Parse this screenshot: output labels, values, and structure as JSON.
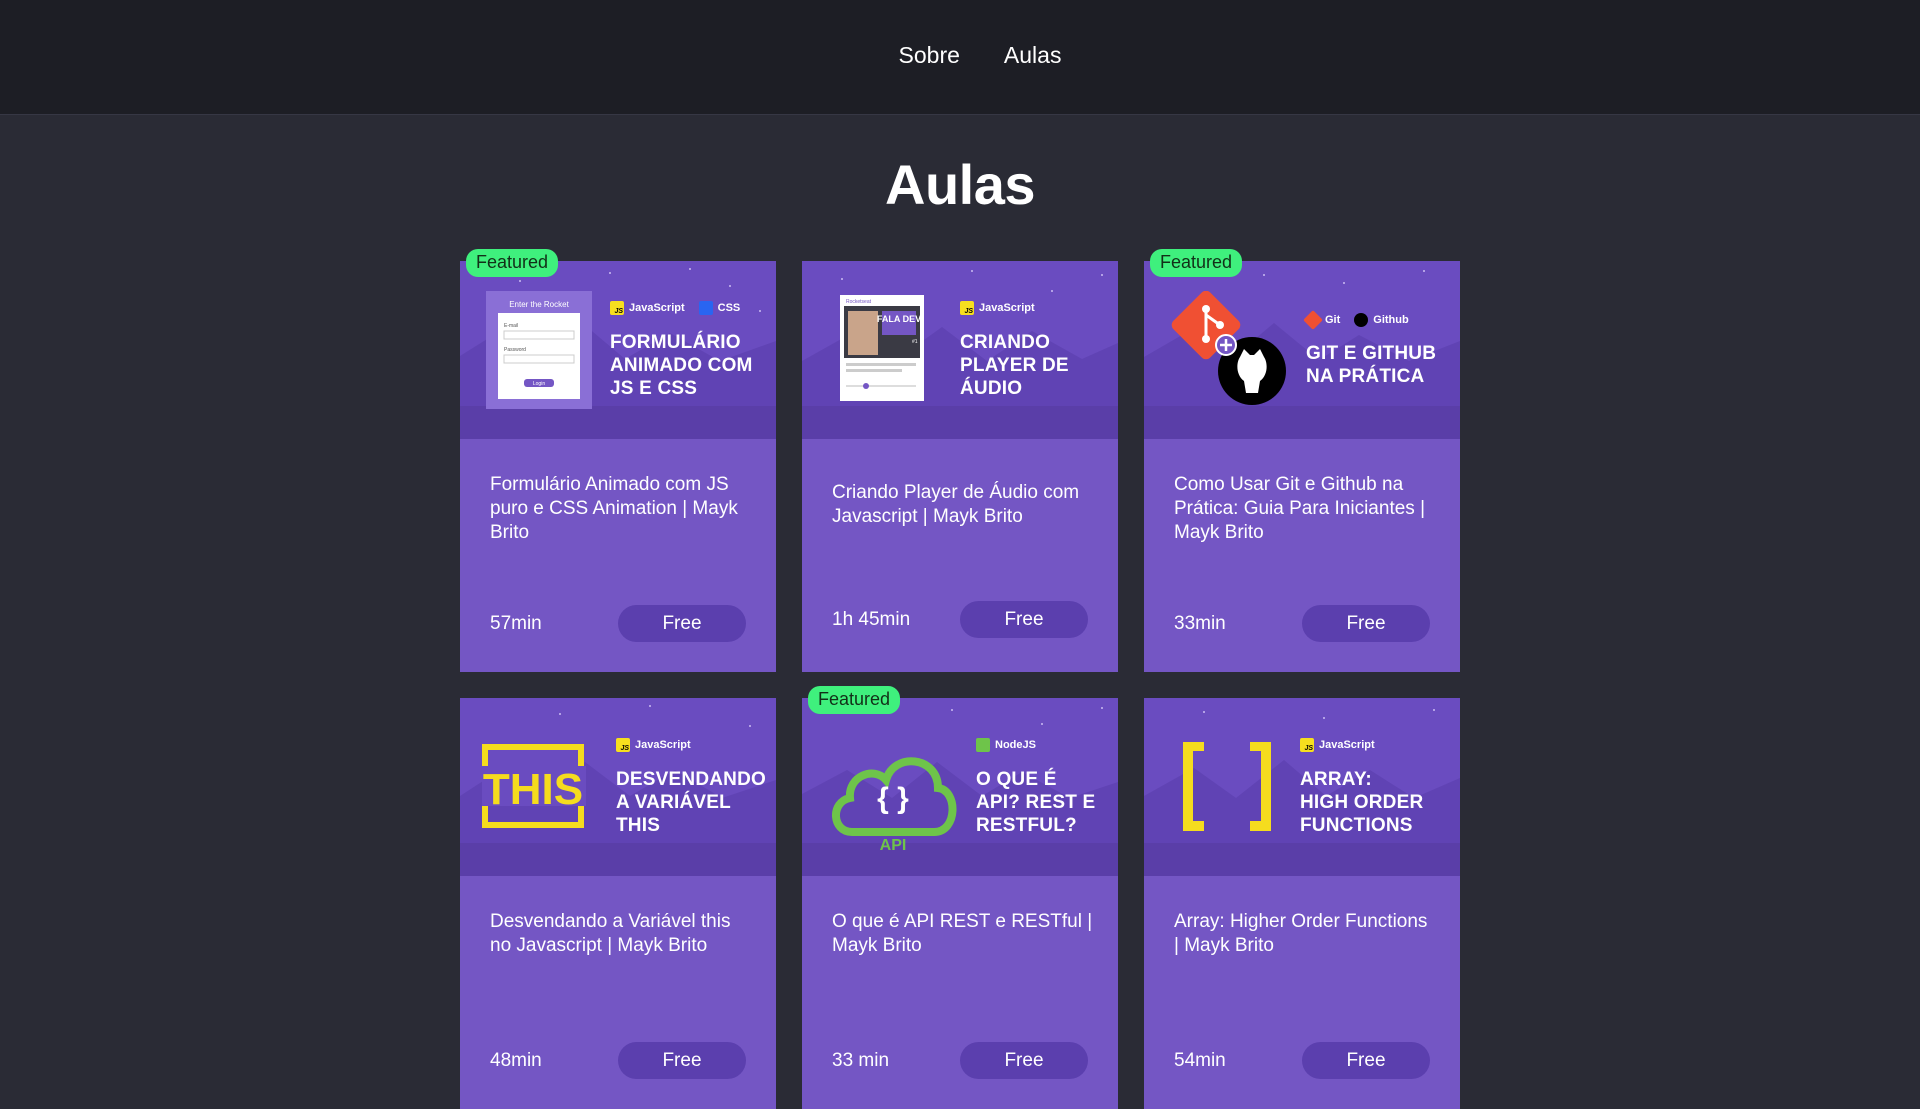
{
  "nav": {
    "items": [
      {
        "label": "Sobre"
      },
      {
        "label": "Aulas"
      }
    ]
  },
  "page": {
    "title": "Aulas"
  },
  "colors": {
    "card": "#7456c4",
    "badge": "#3ff07d",
    "button": "#5b3fae",
    "background": "#2a2b35"
  },
  "lessons": [
    {
      "featured": true,
      "badge": "Featured",
      "thumb": {
        "tags": [
          "JavaScript",
          "CSS"
        ],
        "title": [
          "FORMULÁRIO",
          "ANIMADO COM",
          "JS E CSS"
        ],
        "art": "form-icon",
        "art_text": {
          "heading": "Enter the Rocket",
          "email": "E-mail",
          "password": "Password",
          "button": "Login"
        }
      },
      "title": "Formulário Animado com JS puro e CSS Animation | Mayk Brito",
      "duration": "57min",
      "price": "Free"
    },
    {
      "featured": false,
      "badge": "",
      "thumb": {
        "tags": [
          "JavaScript"
        ],
        "title": [
          "CRIANDO",
          "PLAYER DE",
          "ÁUDIO"
        ],
        "art": "podcast-player-icon",
        "art_text": {
          "brand": "Rocketseat",
          "show": "FALA DEV",
          "episode": "#1"
        }
      },
      "title": "Criando Player de Áudio com Javascript | Mayk Brito",
      "duration": "1h 45min",
      "price": "Free"
    },
    {
      "featured": true,
      "badge": "Featured",
      "thumb": {
        "tags": [
          "Git",
          "Github"
        ],
        "title": [
          "GIT E GITHUB",
          "NA PRÁTICA"
        ],
        "art": "git-github-icon"
      },
      "title": "Como Usar Git e Github na Prática: Guia Para Iniciantes | Mayk Brito",
      "duration": "33min",
      "price": "Free"
    },
    {
      "featured": false,
      "badge": "",
      "thumb": {
        "tags": [
          "JavaScript"
        ],
        "title": [
          "DESVENDANDO",
          "A VARIÁVEL",
          "THIS"
        ],
        "art": "this-keyword-icon",
        "art_text": {
          "word": "THIS"
        }
      },
      "title": "Desvendando a Variável this no Javascript | Mayk Brito",
      "duration": "48min",
      "price": "Free"
    },
    {
      "featured": true,
      "badge": "Featured",
      "thumb": {
        "tags": [
          "NodeJS"
        ],
        "title": [
          "O QUE É",
          "API? REST E",
          "RESTFUL?"
        ],
        "art": "api-cloud-icon",
        "art_text": {
          "braces": "{ }",
          "label": "API"
        }
      },
      "title": "O que é API REST e RESTful | Mayk Brito",
      "duration": "33 min",
      "price": "Free"
    },
    {
      "featured": false,
      "badge": "",
      "thumb": {
        "tags": [
          "JavaScript"
        ],
        "title": [
          "ARRAY:",
          "HIGH ORDER",
          "FUNCTIONS"
        ],
        "art": "array-brackets-icon"
      },
      "title": "Array: Higher Order Functions | Mayk Brito",
      "duration": "54min",
      "price": "Free"
    }
  ]
}
